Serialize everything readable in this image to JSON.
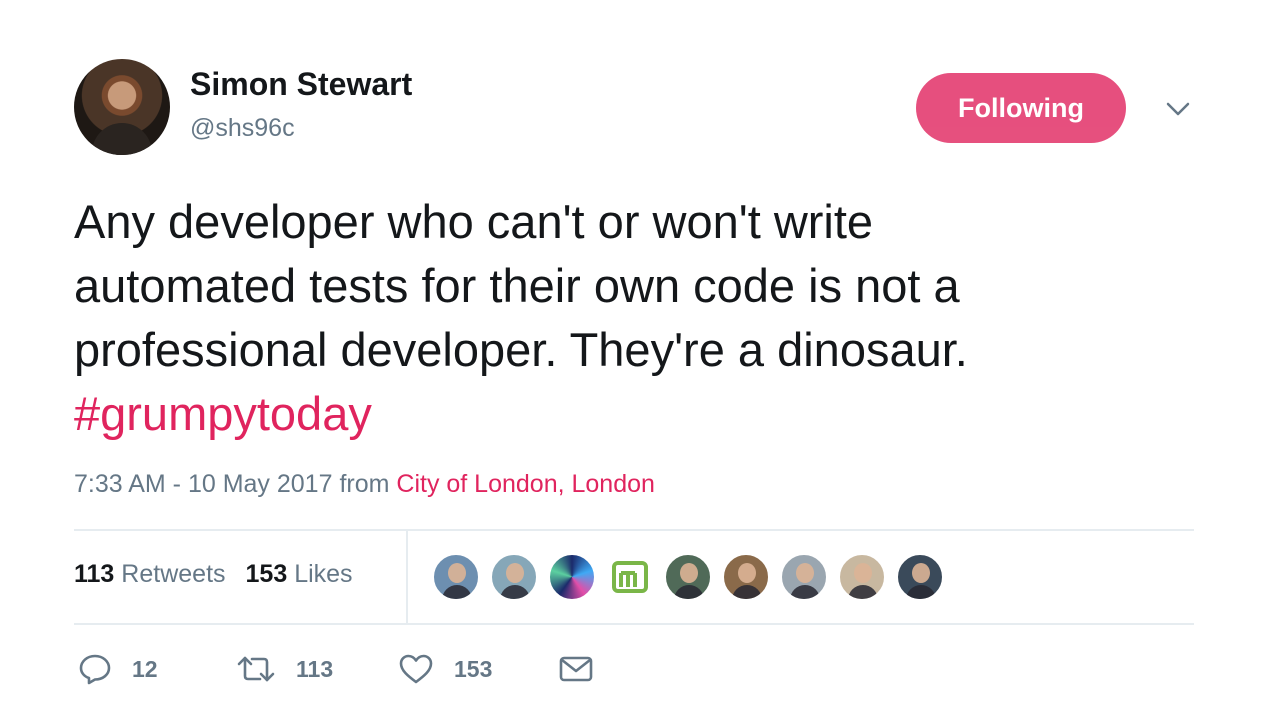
{
  "author": {
    "name": "Simon Stewart",
    "handle": "@shs96c"
  },
  "follow_button": {
    "label": "Following"
  },
  "tweet": {
    "lines": [
      "Any developer who can't or won't write",
      "automated tests for their own code is not a",
      "professional developer. They're a dinosaur."
    ],
    "hashtag": "#grumpytoday"
  },
  "meta": {
    "time": "7:33 AM - 10 May 2017",
    "from_word": "from",
    "location": "City of London, London"
  },
  "stats": {
    "retweets_count": "113",
    "retweets_label": "Retweets",
    "likes_count": "153",
    "likes_label": "Likes"
  },
  "likers": [
    {
      "name": "liker-1",
      "color": "#6d8fb0"
    },
    {
      "name": "liker-2",
      "color": "#86a7b8"
    },
    {
      "name": "liker-3",
      "color": "#1b2a6b"
    },
    {
      "name": "liker-4",
      "color": "#7ab648"
    },
    {
      "name": "liker-5",
      "color": "#506a58"
    },
    {
      "name": "liker-6",
      "color": "#8a6a4a"
    },
    {
      "name": "liker-7",
      "color": "#9aa6b0"
    },
    {
      "name": "liker-8",
      "color": "#c8b8a0"
    },
    {
      "name": "liker-9",
      "color": "#3a4a5a"
    }
  ],
  "actions": {
    "reply_count": "12",
    "retweet_count": "113",
    "like_count": "153"
  },
  "colors": {
    "accent": "#e0245e",
    "muted": "#657786",
    "text": "#14171a",
    "divider": "#e6ecf0"
  }
}
